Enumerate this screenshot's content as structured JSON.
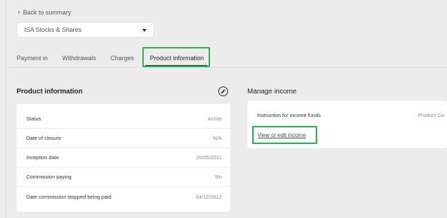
{
  "back_link": {
    "label": "Back to summary"
  },
  "account_select": {
    "value": "ISA Stocks & Shares"
  },
  "tabs": [
    {
      "label": "Payment in"
    },
    {
      "label": "Withdrawals"
    },
    {
      "label": "Charges"
    },
    {
      "label": "Product information",
      "active": true
    }
  ],
  "product_information": {
    "title": "Product information",
    "rows": [
      {
        "label": "Status",
        "value": "Active"
      },
      {
        "label": "Date of closure",
        "value": "N/A"
      },
      {
        "label": "Inception date",
        "value": "20/05/2011"
      },
      {
        "label": "Commission paying",
        "value": "No"
      },
      {
        "label": "Date commission stopped being paid",
        "value": "04/12/2012"
      }
    ]
  },
  "manage_income": {
    "title": "Manage income",
    "row": {
      "label": "Instruction for income funds",
      "value": "Product Ca"
    },
    "link": "View or edit income"
  },
  "colors": {
    "highlight": "#1db44a",
    "background": "#ececec",
    "card": "#ffffff"
  },
  "icons": {
    "back": "chevron-left-icon",
    "select": "caret-down-icon",
    "edit": "pencil-icon"
  }
}
